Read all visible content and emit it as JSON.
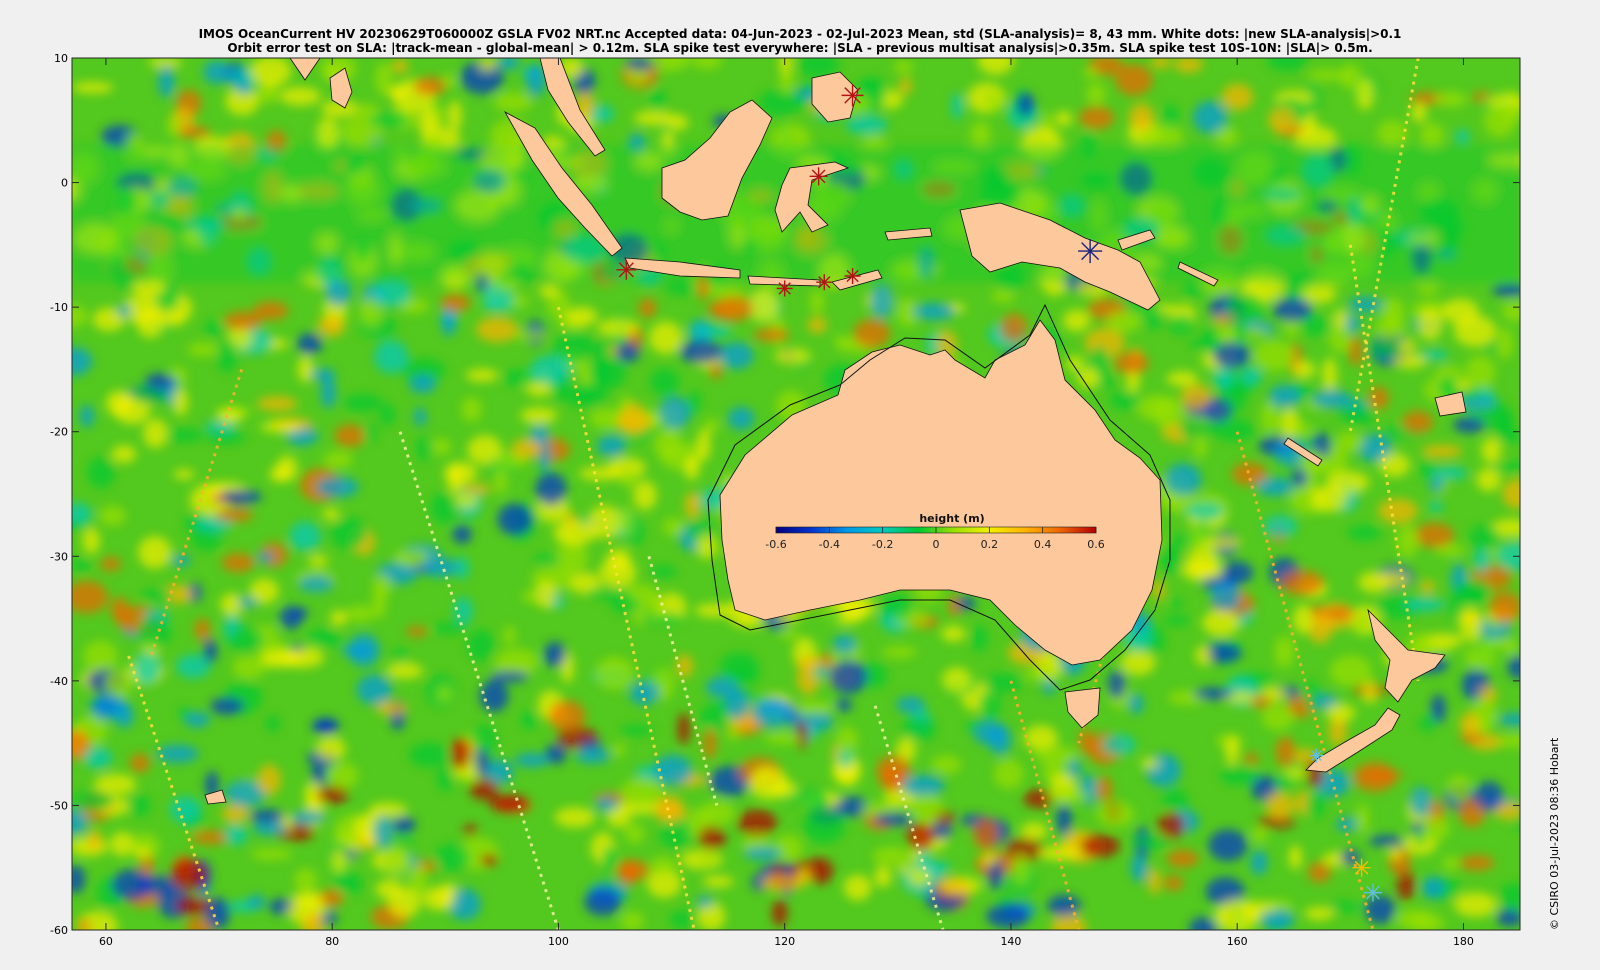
{
  "title": {
    "line1": "IMOS OceanCurrent HV 20230629T060000Z GSLA FV02 NRT.nc  Accepted data: 04-Jun-2023 - 02-Jul-2023 Mean, std (SLA-analysis)= 8, 43 mm. White dots: |new SLA-analysis|>0.1",
    "line2": "Orbit error test on SLA: |track-mean  - global-mean| > 0.12m.  SLA spike test everywhere: |SLA - previous multisat analysis|>0.35m. SLA spike test 10S-10N: |SLA|> 0.5m."
  },
  "credit": "© CSIRO 03-Jul-2023 08:36 Hobart",
  "map": {
    "lon_range": [
      57,
      185
    ],
    "lat_range": [
      -60,
      10
    ],
    "x_ticks": [
      "60",
      "80",
      "100",
      "120",
      "140",
      "160",
      "180"
    ],
    "y_ticks": [
      "10",
      "0",
      "-10",
      "-20",
      "-30",
      "-40",
      "-50",
      "-60"
    ],
    "land_color": "#fcc89c",
    "ocean_base_color": "#53c81e"
  },
  "colorbar": {
    "title": "height (m)",
    "ticks": [
      "-0.6",
      "-0.4",
      "-0.2",
      "0",
      "0.2",
      "0.4",
      "0.6"
    ],
    "colors": [
      "#00007f",
      "#0033cc",
      "#0099e6",
      "#00c9c0",
      "#00c832",
      "#9be000",
      "#f4f000",
      "#ffb400",
      "#f06400",
      "#b40000"
    ]
  },
  "markers": {
    "red": "#b41414",
    "blue": "#1a237e"
  }
}
